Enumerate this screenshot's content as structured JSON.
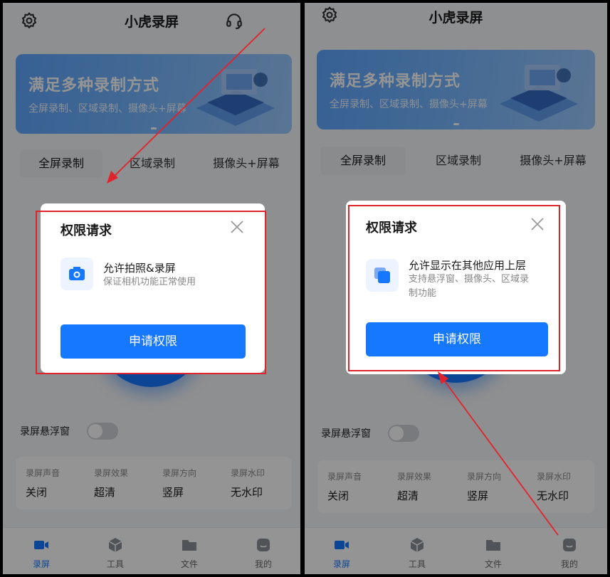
{
  "app": {
    "title": "小虎录屏"
  },
  "banner": {
    "title": "满足多种录制方式",
    "subtitle": "全屏录制、区域录制、摄像头+屏幕"
  },
  "tabs": [
    "全屏录制",
    "区域录制",
    "摄像头+屏幕"
  ],
  "float_window": {
    "label": "录屏悬浮窗",
    "enabled": false
  },
  "settings": [
    {
      "key": "录屏声音",
      "value": "关闭"
    },
    {
      "key": "录屏效果",
      "value": "超清"
    },
    {
      "key": "录屏方向",
      "value": "竖屏"
    },
    {
      "key": "录屏水印",
      "value": "无水印"
    }
  ],
  "nav": [
    {
      "label": "录屏",
      "icon": "video-camera-icon"
    },
    {
      "label": "工具",
      "icon": "cube-icon"
    },
    {
      "label": "文件",
      "icon": "folder-icon"
    },
    {
      "label": "我的",
      "icon": "smile-face-icon"
    }
  ],
  "dialog_left": {
    "title": "权限请求",
    "perm_title": "允许拍照&录屏",
    "perm_desc": "保证相机功能正常使用",
    "button": "申请权限",
    "icon": "camera-icon"
  },
  "dialog_right": {
    "title": "权限请求",
    "perm_title": "允许显示在其他应用上层",
    "perm_desc_line1": "支持悬浮窗、摄像头、区域录",
    "perm_desc_line2": "制功能",
    "button": "申请权限",
    "icon": "overlay-windows-icon"
  },
  "colors": {
    "primary": "#1677ff",
    "annotation": "#e0242b"
  }
}
